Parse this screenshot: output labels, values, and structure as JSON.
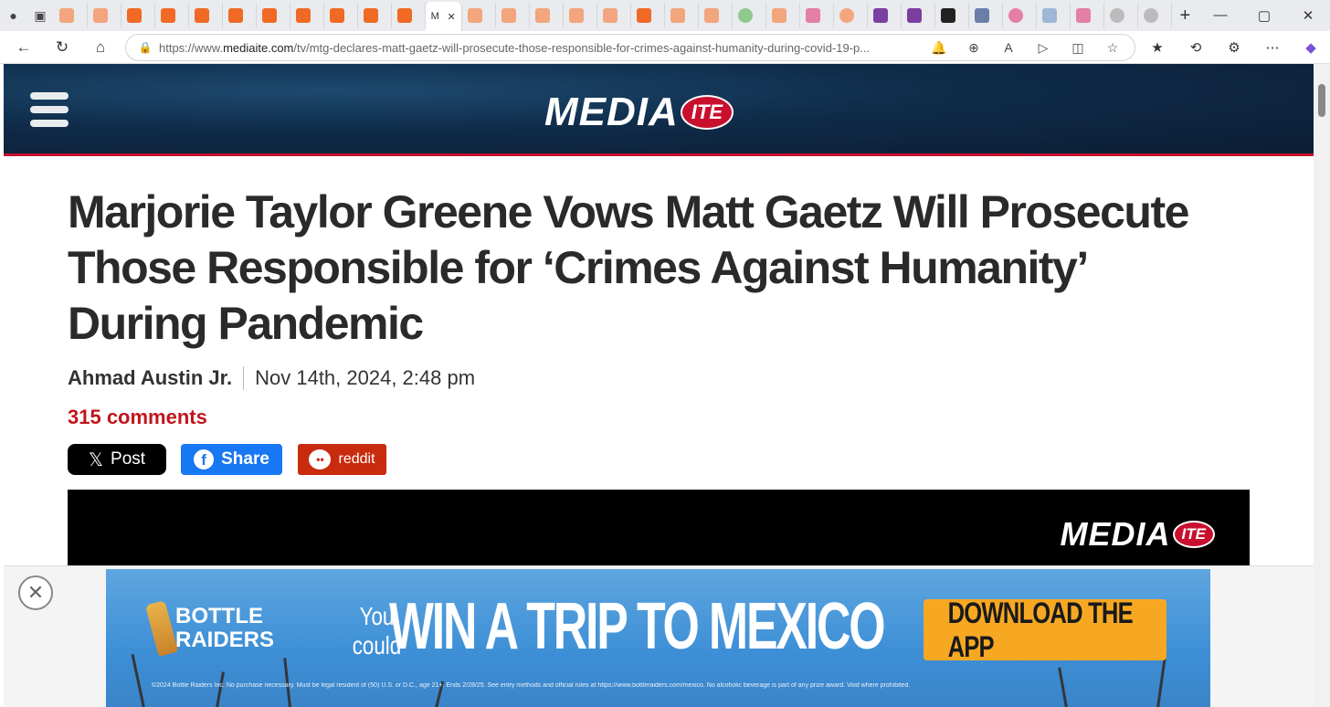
{
  "browser": {
    "active_tab_title": "M",
    "url_prefix": "https://www.",
    "url_domain": "mediaite.com",
    "url_path": "/tv/mtg-declares-matt-gaetz-will-prosecute-those-responsible-for-crimes-against-humanity-during-covid-19-p...",
    "new_tab_label": "+",
    "window_controls": {
      "minimize": "—",
      "maximize": "▢",
      "close": "✕"
    }
  },
  "site": {
    "logo_main": "MEDIA",
    "logo_badge": "ITE"
  },
  "article": {
    "headline": "Marjorie Taylor Greene Vows Matt Gaetz Will Prosecute Those Responsible for ‘Crimes Against Humanity’ During Pandemic",
    "author": "Ahmad Austin Jr.",
    "date": "Nov 14th, 2024, 2:48 pm",
    "comments": "315 comments"
  },
  "share": {
    "x_label": "Post",
    "facebook_label": "Share",
    "reddit_label": "reddit"
  },
  "video": {
    "logo_main": "MEDIA",
    "logo_badge": "ITE"
  },
  "ad": {
    "close": "✕",
    "brand_line1": "BOTTLE",
    "brand_line2": "RAIDERS",
    "you_line1": "You",
    "you_line2": "could",
    "headline": "WIN A TRIP TO MEXICO",
    "cta": "DOWNLOAD THE APP",
    "fine_print": "©2024 Bottle Raiders Inc. No purchase necessary. Must be legal resident of (50) U.S. or D.C., age 21+. Ends 2/28/25. See entry methods and official rules at https://www.bottleraiders.com/mexico. No alcoholic beverage is part of any prize award. Void where prohibited."
  }
}
